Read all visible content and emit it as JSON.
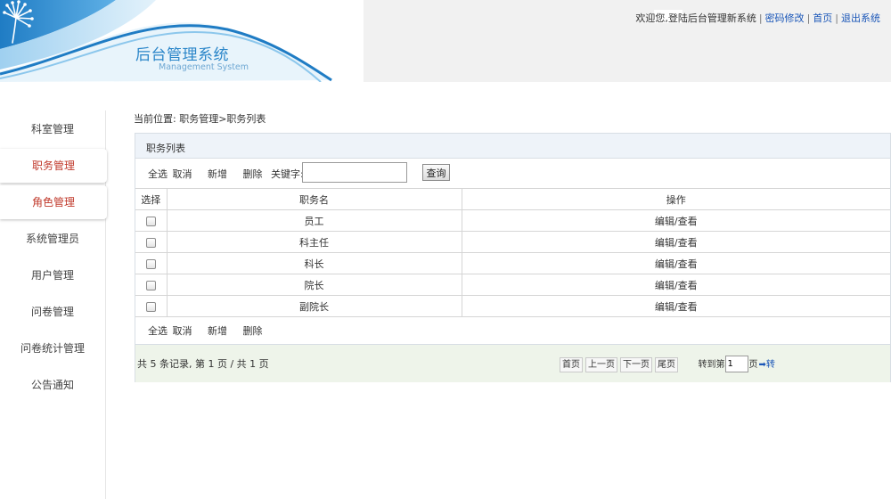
{
  "header": {
    "system_title": "后台管理系统",
    "system_subtitle": "Management System",
    "welcome_text": "欢迎您,登陆后台管理新系统",
    "change_password": "密码修改",
    "home": "首页",
    "logout": "退出系统",
    "separator": "|"
  },
  "sidebar": {
    "items": [
      {
        "label": "科室管理",
        "active": false
      },
      {
        "label": "职务管理",
        "active": true
      },
      {
        "label": "角色管理",
        "active": true
      },
      {
        "label": "系统管理员",
        "active": false
      },
      {
        "label": "用户管理",
        "active": false
      },
      {
        "label": "问卷管理",
        "active": false
      },
      {
        "label": "问卷统计管理",
        "active": false
      },
      {
        "label": "公告通知",
        "active": false
      }
    ]
  },
  "breadcrumb": "当前位置: 职务管理>职务列表",
  "panel": {
    "title": "职务列表",
    "toolbar": {
      "select_all": "全选",
      "cancel": "取消",
      "add": "新增",
      "delete": "删除",
      "keyword_label": "关键字:",
      "keyword_value": "",
      "query_button": "查询"
    },
    "table": {
      "columns": [
        "选择",
        "职务名",
        "操作"
      ],
      "rows": [
        {
          "name": "员工",
          "action": "编辑/查看"
        },
        {
          "name": "科主任",
          "action": "编辑/查看"
        },
        {
          "name": "科长",
          "action": "编辑/查看"
        },
        {
          "name": "院长",
          "action": "编辑/查看"
        },
        {
          "name": "副院长",
          "action": "编辑/查看"
        }
      ]
    },
    "pagination": {
      "record_info": "共 5 条记录, 第 1 页 / 共 1 页",
      "first": "首页",
      "prev": "上一页",
      "next": "下一页",
      "last": "尾页",
      "goto_label": "转到第",
      "page_value": "1",
      "page_unit": "页",
      "go": "➡转"
    }
  },
  "colors": {
    "brand_blue": "#2b86c9",
    "active_nav_text": "#c0392b",
    "link_blue": "#1a56b8",
    "panel_header_bg": "#eef3f9",
    "footer_bg": "#eef4ea"
  },
  "icons": {
    "logo": "dandelion-logo-icon",
    "go": "arrow-right-icon"
  }
}
